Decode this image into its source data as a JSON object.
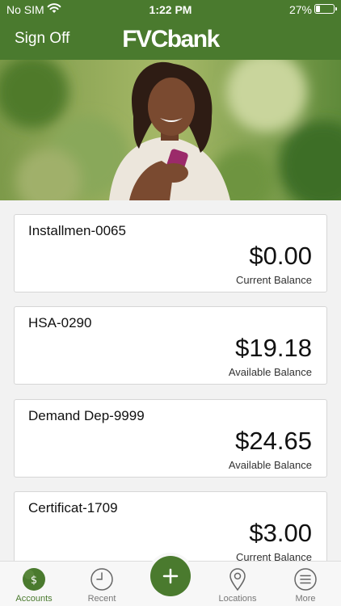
{
  "status_bar": {
    "carrier": "No SIM",
    "time": "1:22 PM",
    "battery_pct": "27%",
    "battery_level": 0.27
  },
  "header": {
    "sign_off_label": "Sign Off",
    "logo_text": "FVCbank"
  },
  "accounts": [
    {
      "name": "Installmen-0065",
      "balance": "$0.00",
      "balance_label": "Current Balance"
    },
    {
      "name": "HSA-0290",
      "balance": "$19.18",
      "balance_label": "Available Balance"
    },
    {
      "name": "Demand Dep-9999",
      "balance": "$24.65",
      "balance_label": "Available Balance"
    },
    {
      "name": "Certificat-1709",
      "balance": "$3.00",
      "balance_label": "Current Balance"
    }
  ],
  "tabbar": {
    "tabs": [
      {
        "label": "Accounts",
        "icon": "dollar-icon",
        "active": true
      },
      {
        "label": "Recent",
        "icon": "clock-icon",
        "active": false
      },
      {
        "label": "Locations",
        "icon": "location-pin-icon",
        "active": false
      },
      {
        "label": "More",
        "icon": "menu-icon",
        "active": false
      }
    ],
    "add_icon": "plus-icon"
  },
  "colors": {
    "brand": "#4a7a2e",
    "background": "#f2f2f2",
    "card": "#ffffff"
  }
}
